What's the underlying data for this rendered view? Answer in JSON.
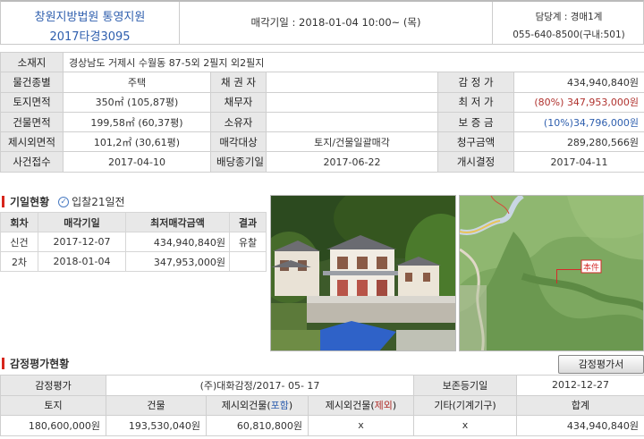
{
  "header": {
    "court": "창원지방법원 통영지원",
    "case_no": "2017타경3095",
    "sale_date": "매각기일 : 2018-01-04  10:00~ (목)",
    "dept": "담당계 : 경매1계",
    "phone": "055-640-8500(구내:501)"
  },
  "info": {
    "address_label": "소재지",
    "address": "경상남도 거제시 수월동 87-5외 2필지",
    "address_suffix": "외2필지",
    "type_label": "물건종별",
    "type": "주택",
    "creditor_label": "채 권 자",
    "creditor": "",
    "appraisal_label": "감 정 가",
    "appraisal": "434,940,840원",
    "land_label": "토지면적",
    "land": "350㎡ (105,87평)",
    "debtor_label": "채무자",
    "debtor": "",
    "min_label": "최 저 가",
    "min_pct": "(80%)",
    "min_value": "347,953,000원",
    "bldg_label": "건물면적",
    "bldg": "199,58㎡ (60,37평)",
    "owner_label": "소유자",
    "owner": "",
    "deposit_label": "보 증 금",
    "deposit": "(10%)34,796,000원",
    "extra_label": "제시외면적",
    "extra": "101,2㎡ (30,61평)",
    "sale_target_label": "매각대상",
    "sale_target": "토지/건물일괄매각",
    "claim_label": "청구금액",
    "claim": "289,280,566원",
    "receipt_label": "사건접수",
    "receipt": "2017-04-10",
    "dividend_label": "배당종기일",
    "dividend": "2017-06-22",
    "start_label": "개시결정",
    "start": "2017-04-11"
  },
  "history": {
    "title": "기일현황",
    "days_badge": "입찰21일전",
    "headers": [
      "회차",
      "매각기일",
      "최저매각금액",
      "결과"
    ],
    "rows": [
      {
        "round": "신건",
        "date": "2017-12-07",
        "amount": "434,940,840원",
        "result": "유찰"
      },
      {
        "round": "2차",
        "date": "2018-01-04",
        "amount": "347,953,000원",
        "result": ""
      }
    ]
  },
  "map": {
    "marker": "本件"
  },
  "appraisal_section": {
    "title": "감정평가현황",
    "button": "감정평가서",
    "label_row1": "감정평가",
    "agency": "(주)대화감정/2017- 05- 17",
    "reg_label": "보존등기일",
    "reg_date": "2012-12-27",
    "headers": {
      "land": "토지",
      "bldg": "건물",
      "ext_incl_a": "제시외건물(",
      "ext_incl_b": "포함",
      "ext_incl_c": ")",
      "ext_excl_a": "제시외건물(",
      "ext_excl_b": "제외",
      "ext_excl_c": ")",
      "etc": "기타(기계기구)",
      "total": "합계"
    },
    "values": {
      "land": "180,600,000원",
      "bldg": "193,530,040원",
      "ext_incl": "60,810,800원",
      "ext_excl": "x",
      "etc": "x",
      "total": "434,940,840원"
    }
  },
  "colors": {
    "red": "#b0322e",
    "blue": "#2f5fae",
    "label_bg": "#e8e8e8"
  }
}
